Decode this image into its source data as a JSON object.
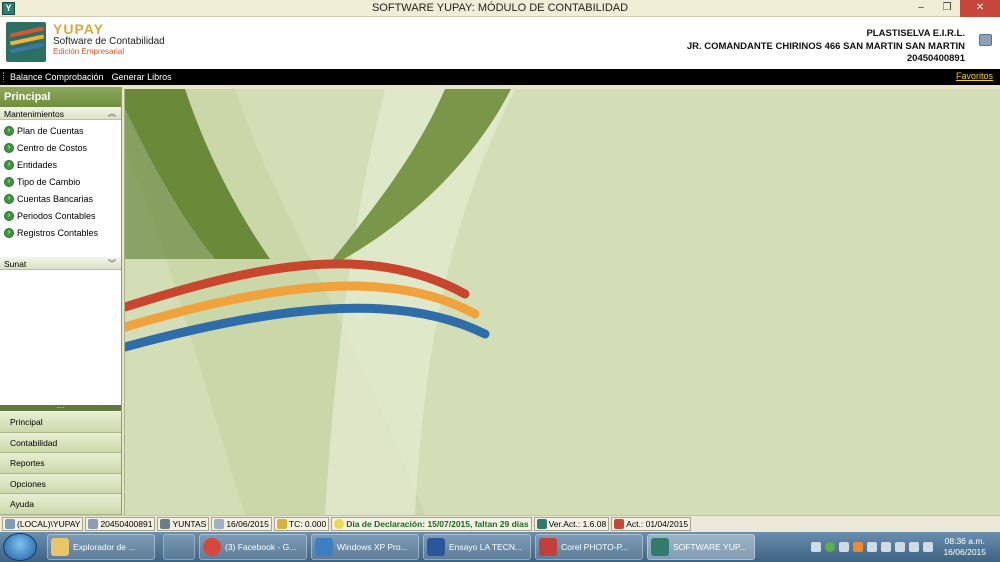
{
  "window": {
    "title": "SOFTWARE YUPAY: MÓDULO DE CONTABILIDAD",
    "minimize": "–",
    "maximize": "❐",
    "close": "✕"
  },
  "brand": {
    "name": "YUPAY",
    "subtitle": "Software de Contabilidad",
    "edition": "Edición Empresarial"
  },
  "company": {
    "name": "PLASTISELVA E.I.R.L.",
    "address": "JR.  COMANDANTE CHIRINOS 466  SAN MARTIN SAN MARTIN",
    "ruc": "20450400891"
  },
  "menu": {
    "items": [
      "Balance Comprobación",
      "Generar Libros"
    ],
    "favorites": "Favoritos"
  },
  "sidebar": {
    "title": "Principal",
    "mantenimientos": {
      "label": "Mantenimientos",
      "items": [
        "Plan de Cuentas",
        "Centro de Costos",
        "Entidades",
        "Tipo de Cambio",
        "Cuentas Bancarias",
        "Periodos Contables",
        "Registros Contables"
      ]
    },
    "sunat": {
      "label": "Sunat"
    },
    "nav": [
      "Principal",
      "Contabilidad",
      "Reportes",
      "Opciones",
      "Ayuda"
    ]
  },
  "status": {
    "server": "(LOCAL)\\YUPAY",
    "ruc": "20450400891",
    "user": "YUNTAS",
    "date": "16/06/2015",
    "tc": "TC: 0.000",
    "declaration": "Día de Declaración: 15/07/2015, faltan 29 días",
    "version": "Ver.Act.: 1.6.08",
    "updated": "Act.: 01/04/2015"
  },
  "taskbar": {
    "items": [
      "Explorador de ...",
      "(3) Facebook - G...",
      "Windows XP Pro...",
      "Ensayo LA TECN...",
      "Corel PHOTO-P...",
      "SOFTWARE YUP..."
    ],
    "clock_time": "08:36 a.m.",
    "clock_date": "16/06/2015"
  },
  "colors": {
    "accent": "#6f8f3c",
    "main_bg": "#d3deb6",
    "wave_red": "#c8462e",
    "wave_orange": "#f0a23c",
    "wave_blue": "#2e6da8"
  }
}
